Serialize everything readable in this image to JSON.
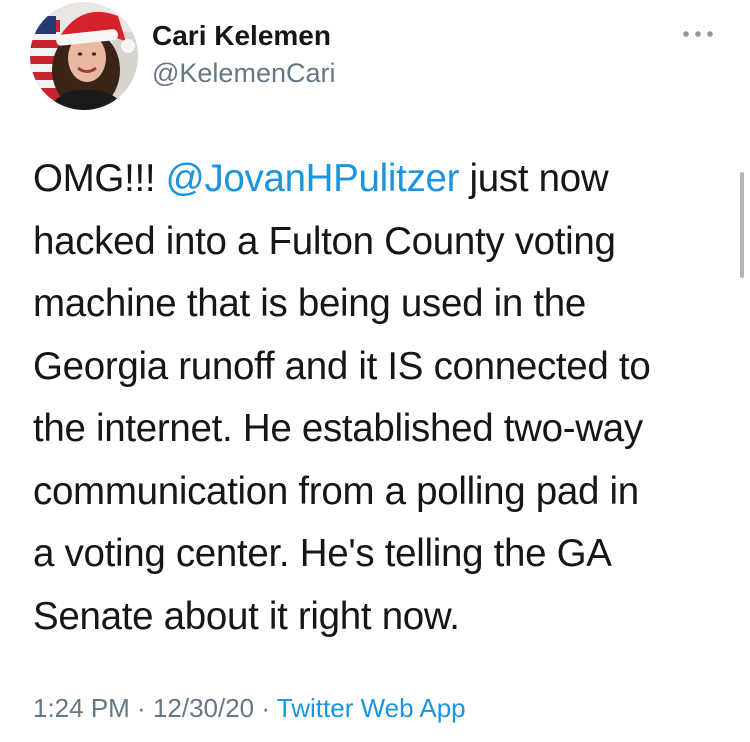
{
  "author": {
    "display_name": "Cari Kelemen",
    "handle": "@KelemenCari"
  },
  "tweet": {
    "text_before": "OMG!!! ",
    "mention": "@JovanHPulitzer",
    "text_lines": [
      " just now",
      "hacked into a Fulton County voting",
      "machine that is being used in the",
      "Georgia runoff and it IS connected to",
      "the internet. He established two-way",
      "communication from a polling pad in",
      "a voting center. He's telling the GA",
      "Senate about it right now."
    ]
  },
  "meta": {
    "time": "1:24 PM",
    "separator": " · ",
    "date": "12/30/20",
    "source": "Twitter Web App"
  },
  "colors": {
    "text": "#14171a",
    "secondary": "#657786",
    "link": "#1b95e0"
  },
  "icons": {
    "more": "more-dots-icon",
    "avatar": "profile-photo"
  }
}
